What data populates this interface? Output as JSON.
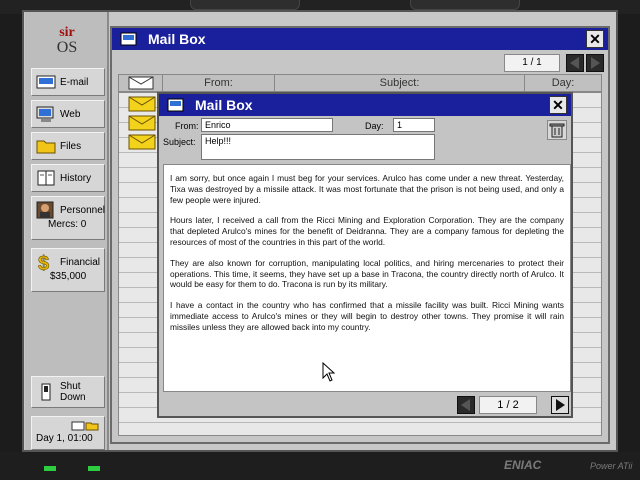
{
  "logo": {
    "top": "sir",
    "bottom": "OS"
  },
  "sidebar": {
    "items": [
      {
        "label": "E-mail",
        "icon": "email-icon"
      },
      {
        "label": "Web",
        "icon": "web-icon"
      },
      {
        "label": "Files",
        "icon": "files-icon"
      },
      {
        "label": "History",
        "icon": "history-icon"
      },
      {
        "label": "Personnel",
        "sub": "Mercs: 0",
        "icon": "personnel-icon"
      },
      {
        "label": "Financial",
        "sub": "$35,000",
        "icon": "dollar-icon"
      },
      {
        "label": "Shut Down",
        "icon": "power-switch-icon"
      }
    ],
    "clock": "Day 1, 01:00"
  },
  "mailbox": {
    "title": "Mail Box",
    "page": "1 / 1",
    "columns": [
      "From:",
      "Subject:",
      "Day:"
    ]
  },
  "message": {
    "title": "Mail Box",
    "from_label": "From:",
    "from_value": "Enrico",
    "day_label": "Day:",
    "day_value": "1",
    "subject_label": "Subject:",
    "subject_value": "Help!!!",
    "paragraphs": [
      "I am sorry, but once again I must beg for your services. Arulco has come under a new threat. Yesterday, Tixa was destroyed by a missile attack. It was most fortunate that the prison is not being used, and only a few people were injured.",
      "Hours later, I received a call from the Ricci Mining and Exploration Corporation. They are the company that depleted Arulco's mines for the benefit of Deidranna. They are a company famous for depleting the resources of most of the countries in this part of the world.",
      "They are also known for corruption, manipulating local politics, and hiring mercenaries to protect their operations. This time, it seems, they have set up a base in Tracona, the country directly north of Arulco. It would be easy for them to do. Tracona is run by its military.",
      "I have a contact in the country who has confirmed that a missile facility was built. Ricci Mining wants immediate access to Arulco's mines or they will begin to destroy other towns. They promise it will rain missiles unless they are allowed back into my country."
    ],
    "page": "1 / 2"
  },
  "brand": {
    "name": "ENIAC",
    "model": "Power ATii"
  },
  "colors": {
    "title_bar": "#1a1f9c",
    "envelope": "#f2d21b",
    "led": "#2ecc40"
  }
}
